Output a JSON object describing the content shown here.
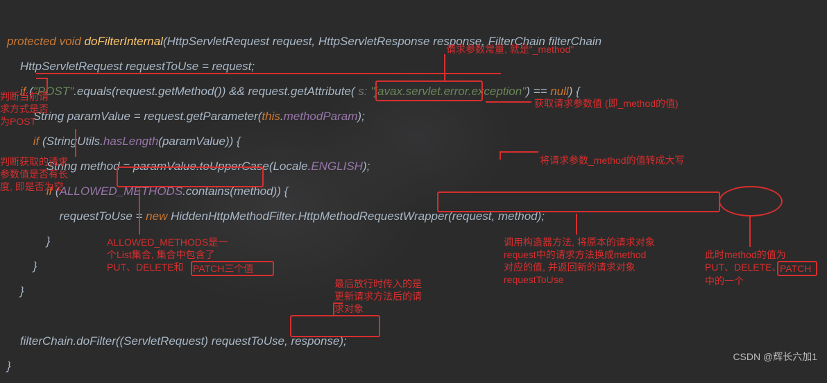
{
  "code": {
    "l1": {
      "kw1": "protected",
      "kw2": "void",
      "fn": "doFilterInternal",
      "params": "(HttpServletRequest request, HttpServletResponse response, FilterChain filterChain"
    },
    "l2": "HttpServletRequest requestToUse = request;",
    "l3": {
      "kw": "if",
      "open": " (",
      "str": "\"POST\"",
      "mid": ".equals(request.getMethod()) && request.getAttribute(",
      "hint": " s: ",
      "str2": "\"javax.servlet.error.exception\"",
      "after": ") == ",
      "null": "null",
      "close": ") {"
    },
    "l4": {
      "a": "String paramValue = request.getParameter(",
      "this": "this",
      "dot": ".",
      "field": "methodParam",
      "b": ");"
    },
    "l5": {
      "kw": "if",
      "a": " (StringUtils.",
      "m": "hasLength",
      "b": "(paramValue)) {"
    },
    "l6": {
      "a": "String method = paramValue.toUpperCase(Locale.",
      "f": "ENGLISH",
      "b": ");"
    },
    "l7": {
      "kw": "if",
      "a": " (",
      "f": "ALLOWED_METHODS",
      "b": ".contains(method)) {"
    },
    "l8": {
      "a": "requestToUse = ",
      "new": "new",
      "b": " HiddenHttpMethodFilter.HttpMethodRequestWrapper(request, method);"
    },
    "l9": "}",
    "l10": "}",
    "l11": "}",
    "l12": "filterChain.doFilter((ServletRequest) requestToUse, response);",
    "l13": "}"
  },
  "notes": {
    "top1": "请求参数常量, 就是\"_method\"",
    "leftA": "判断当前请\n求方式是否\n为POST",
    "leftB": "判断获取的请求\n参数值是否有长\n度, 即是否为空",
    "getParamVal": "获取请求参数值 (即_method的值)",
    "toUpper": "将请求参数_method的值转成大写",
    "allowed": "ALLOWED_METHODS是一\n个List集合, 集合中包含了\nPUT、DELETE和",
    "allowedTail": "PATCH三个值",
    "lastPass": "最后放行时传入的是\n更新请求方法后的请\n求对象",
    "callCtor": "调用构造器方法, 将原本的请求对象\nrequest中的请求方法换成method\n对应的值, 并返回新的请求对象\nrequestToUse",
    "methodNow": "此时method的值为\nPUT、DELETE、",
    "methodNowTail": "PATCH",
    "methodNowTail2": "\n中的一个"
  },
  "watermark": "CSDN @辉长六加1"
}
